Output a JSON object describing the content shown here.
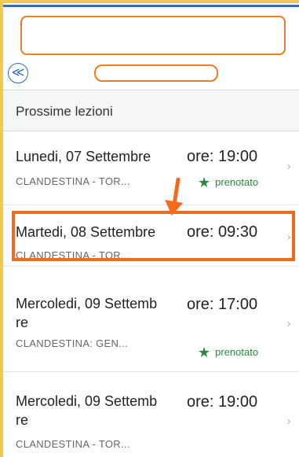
{
  "nav": {
    "back_icon": "double-chevron-left-icon",
    "back_glyph": "≪"
  },
  "section": {
    "title": "Prossime lezioni"
  },
  "lessons": [
    {
      "date": "Lunedi, 07 Settembre",
      "time": "ore: 19:00",
      "place": "CLANDESTINA - TOR...",
      "status": "prenotato"
    },
    {
      "date": "Martedi, 08 Settembre",
      "time": "ore: 09:30",
      "place": "CLANDESTINA - TOR...",
      "status": ""
    },
    {
      "date_line1": "Mercoledi, 09 Settemb",
      "date_line2": "re",
      "time": "ore: 17:00",
      "place": "CLANDESTINA: GEN...",
      "status": "prenotato"
    },
    {
      "date_line1": "Mercoledi, 09 Settemb",
      "date_line2": "re",
      "time": "ore: 19:00",
      "place": "CLANDESTINA - TOR...",
      "status": ""
    }
  ],
  "glyphs": {
    "chevron": "›",
    "star": "★"
  },
  "colors": {
    "accent_blue": "#2e6fb4",
    "highlight_orange": "#f26b1d",
    "badge_green": "#2b8a3e",
    "frame_yellow": "#f2c94c"
  }
}
